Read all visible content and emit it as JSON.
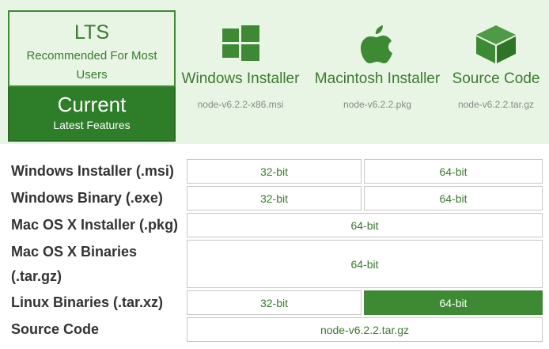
{
  "tabs": {
    "lts": {
      "title": "LTS",
      "subtitle": "Recommended For Most Users"
    },
    "current": {
      "title": "Current",
      "subtitle": "Latest Features"
    }
  },
  "downloads": [
    {
      "label": "Windows Installer",
      "file": "node-v6.2.2-x86.msi",
      "icon": "windows-icon"
    },
    {
      "label": "Macintosh Installer",
      "file": "node-v6.2.2.pkg",
      "icon": "apple-icon"
    },
    {
      "label": "Source Code",
      "file": "node-v6.2.2.tar.gz",
      "icon": "box-icon"
    }
  ],
  "table": {
    "rows": [
      {
        "label": "Windows Installer (.msi)",
        "cells": [
          "32-bit",
          "64-bit"
        ]
      },
      {
        "label": "Windows Binary (.exe)",
        "cells": [
          "32-bit",
          "64-bit"
        ]
      },
      {
        "label": "Mac OS X Installer (.pkg)",
        "cells": [
          "64-bit"
        ]
      },
      {
        "label_line1": "Mac OS X Binaries",
        "label_line2": "(.tar.gz)",
        "cells": [
          "64-bit"
        ]
      },
      {
        "label": "Linux Binaries (.tar.xz)",
        "cells": [
          "32-bit",
          "64-bit"
        ],
        "active_cell": "64-bit"
      },
      {
        "label": "Source Code",
        "cells": [
          "node-v6.2.2.tar.gz"
        ]
      }
    ]
  },
  "colors": {
    "brand_green": "#3e8a34",
    "panel_bg": "#e8f5e4",
    "text_green": "#3b7a2f"
  }
}
